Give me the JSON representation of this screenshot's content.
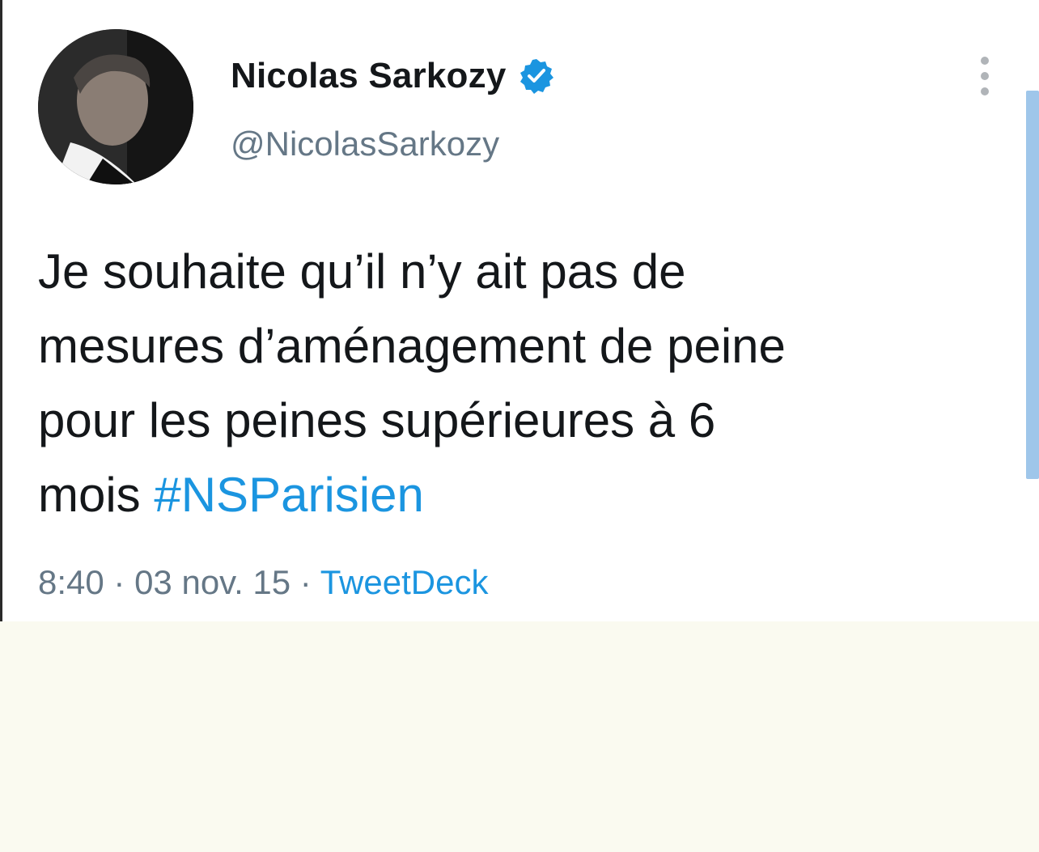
{
  "tweet": {
    "display_name": "Nicolas Sarkozy",
    "verified_icon": "verified-badge-icon",
    "handle": "@NicolasSarkozy",
    "menu_icon": "more-vertical-icon",
    "text_lines": [
      "Je souhaite qu’il n’y ait pas de",
      "mesures d’aménagement de peine",
      "pour les peines supérieures à 6"
    ],
    "last_line_text": "mois ",
    "hashtag": "#NSParisien",
    "time": "8:40",
    "separator": " · ",
    "date": "03 nov. 15",
    "source": "TweetDeck"
  },
  "colors": {
    "text": "#14171a",
    "secondary": "#657786",
    "link": "#1b95e0",
    "background_below": "#fafaf0",
    "scrollbar": "#9fc6ea"
  }
}
